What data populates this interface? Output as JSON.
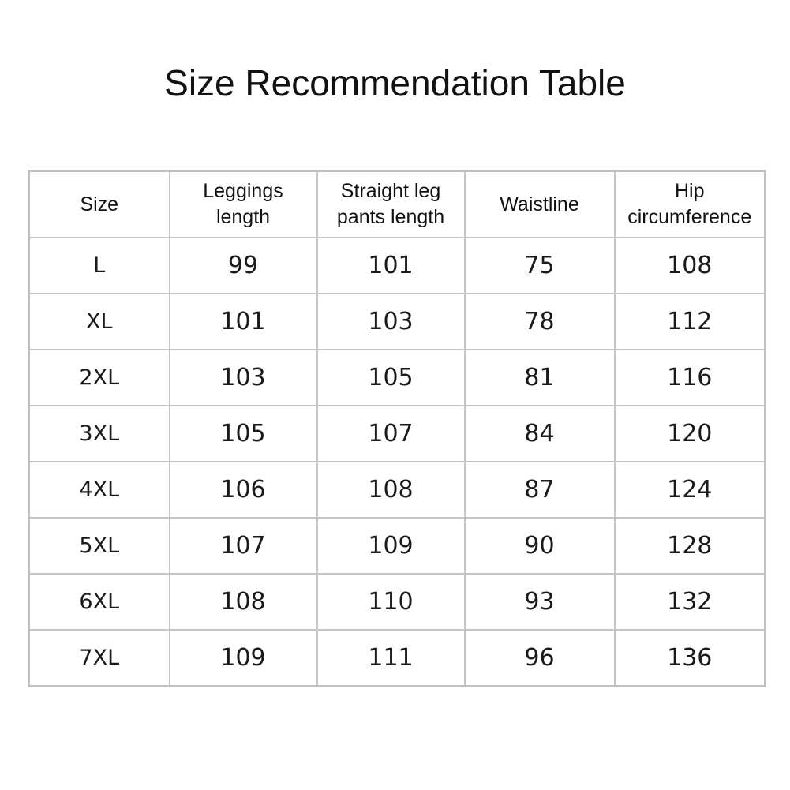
{
  "title": "Size Recommendation Table",
  "table": {
    "headers": [
      {
        "line1": "Size",
        "line2": ""
      },
      {
        "line1": "Leggings",
        "line2": "length"
      },
      {
        "line1": "Straight leg",
        "line2": "pants length"
      },
      {
        "line1": "Waistline",
        "line2": ""
      },
      {
        "line1": "Hip",
        "line2": "circumference"
      }
    ],
    "rows": [
      [
        "L",
        "99",
        "101",
        "75",
        "108"
      ],
      [
        "XL",
        "101",
        "103",
        "78",
        "112"
      ],
      [
        "2XL",
        "103",
        "105",
        "81",
        "116"
      ],
      [
        "3XL",
        "105",
        "107",
        "84",
        "120"
      ],
      [
        "4XL",
        "106",
        "108",
        "87",
        "124"
      ],
      [
        "5XL",
        "107",
        "109",
        "90",
        "128"
      ],
      [
        "6XL",
        "108",
        "110",
        "93",
        "132"
      ],
      [
        "7XL",
        "109",
        "111",
        "96",
        "136"
      ]
    ]
  }
}
